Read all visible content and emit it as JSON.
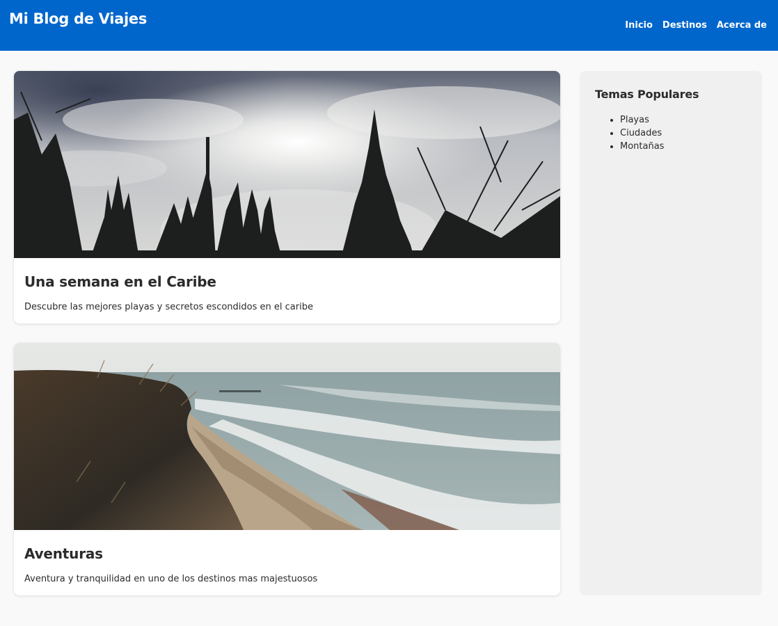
{
  "header": {
    "title": "Mi Blog de Viajes",
    "nav": [
      {
        "label": "Inicio"
      },
      {
        "label": "Destinos"
      },
      {
        "label": "Acerca de"
      }
    ],
    "background": "#0066cc"
  },
  "posts": [
    {
      "title": "Una semana en el Caribe",
      "description": "Descubre las mejores playas y secretos escondidos en el caribe",
      "image": "forest-fog-photo"
    },
    {
      "title": "Aventuras",
      "description": "Aventura y tranquilidad en uno de los destinos mas majestuosos",
      "image": "coastal-beach-photo"
    }
  ],
  "sidebar": {
    "title": "Temas Populares",
    "topics": [
      "Playas",
      "Ciudades",
      "Montañas"
    ]
  }
}
